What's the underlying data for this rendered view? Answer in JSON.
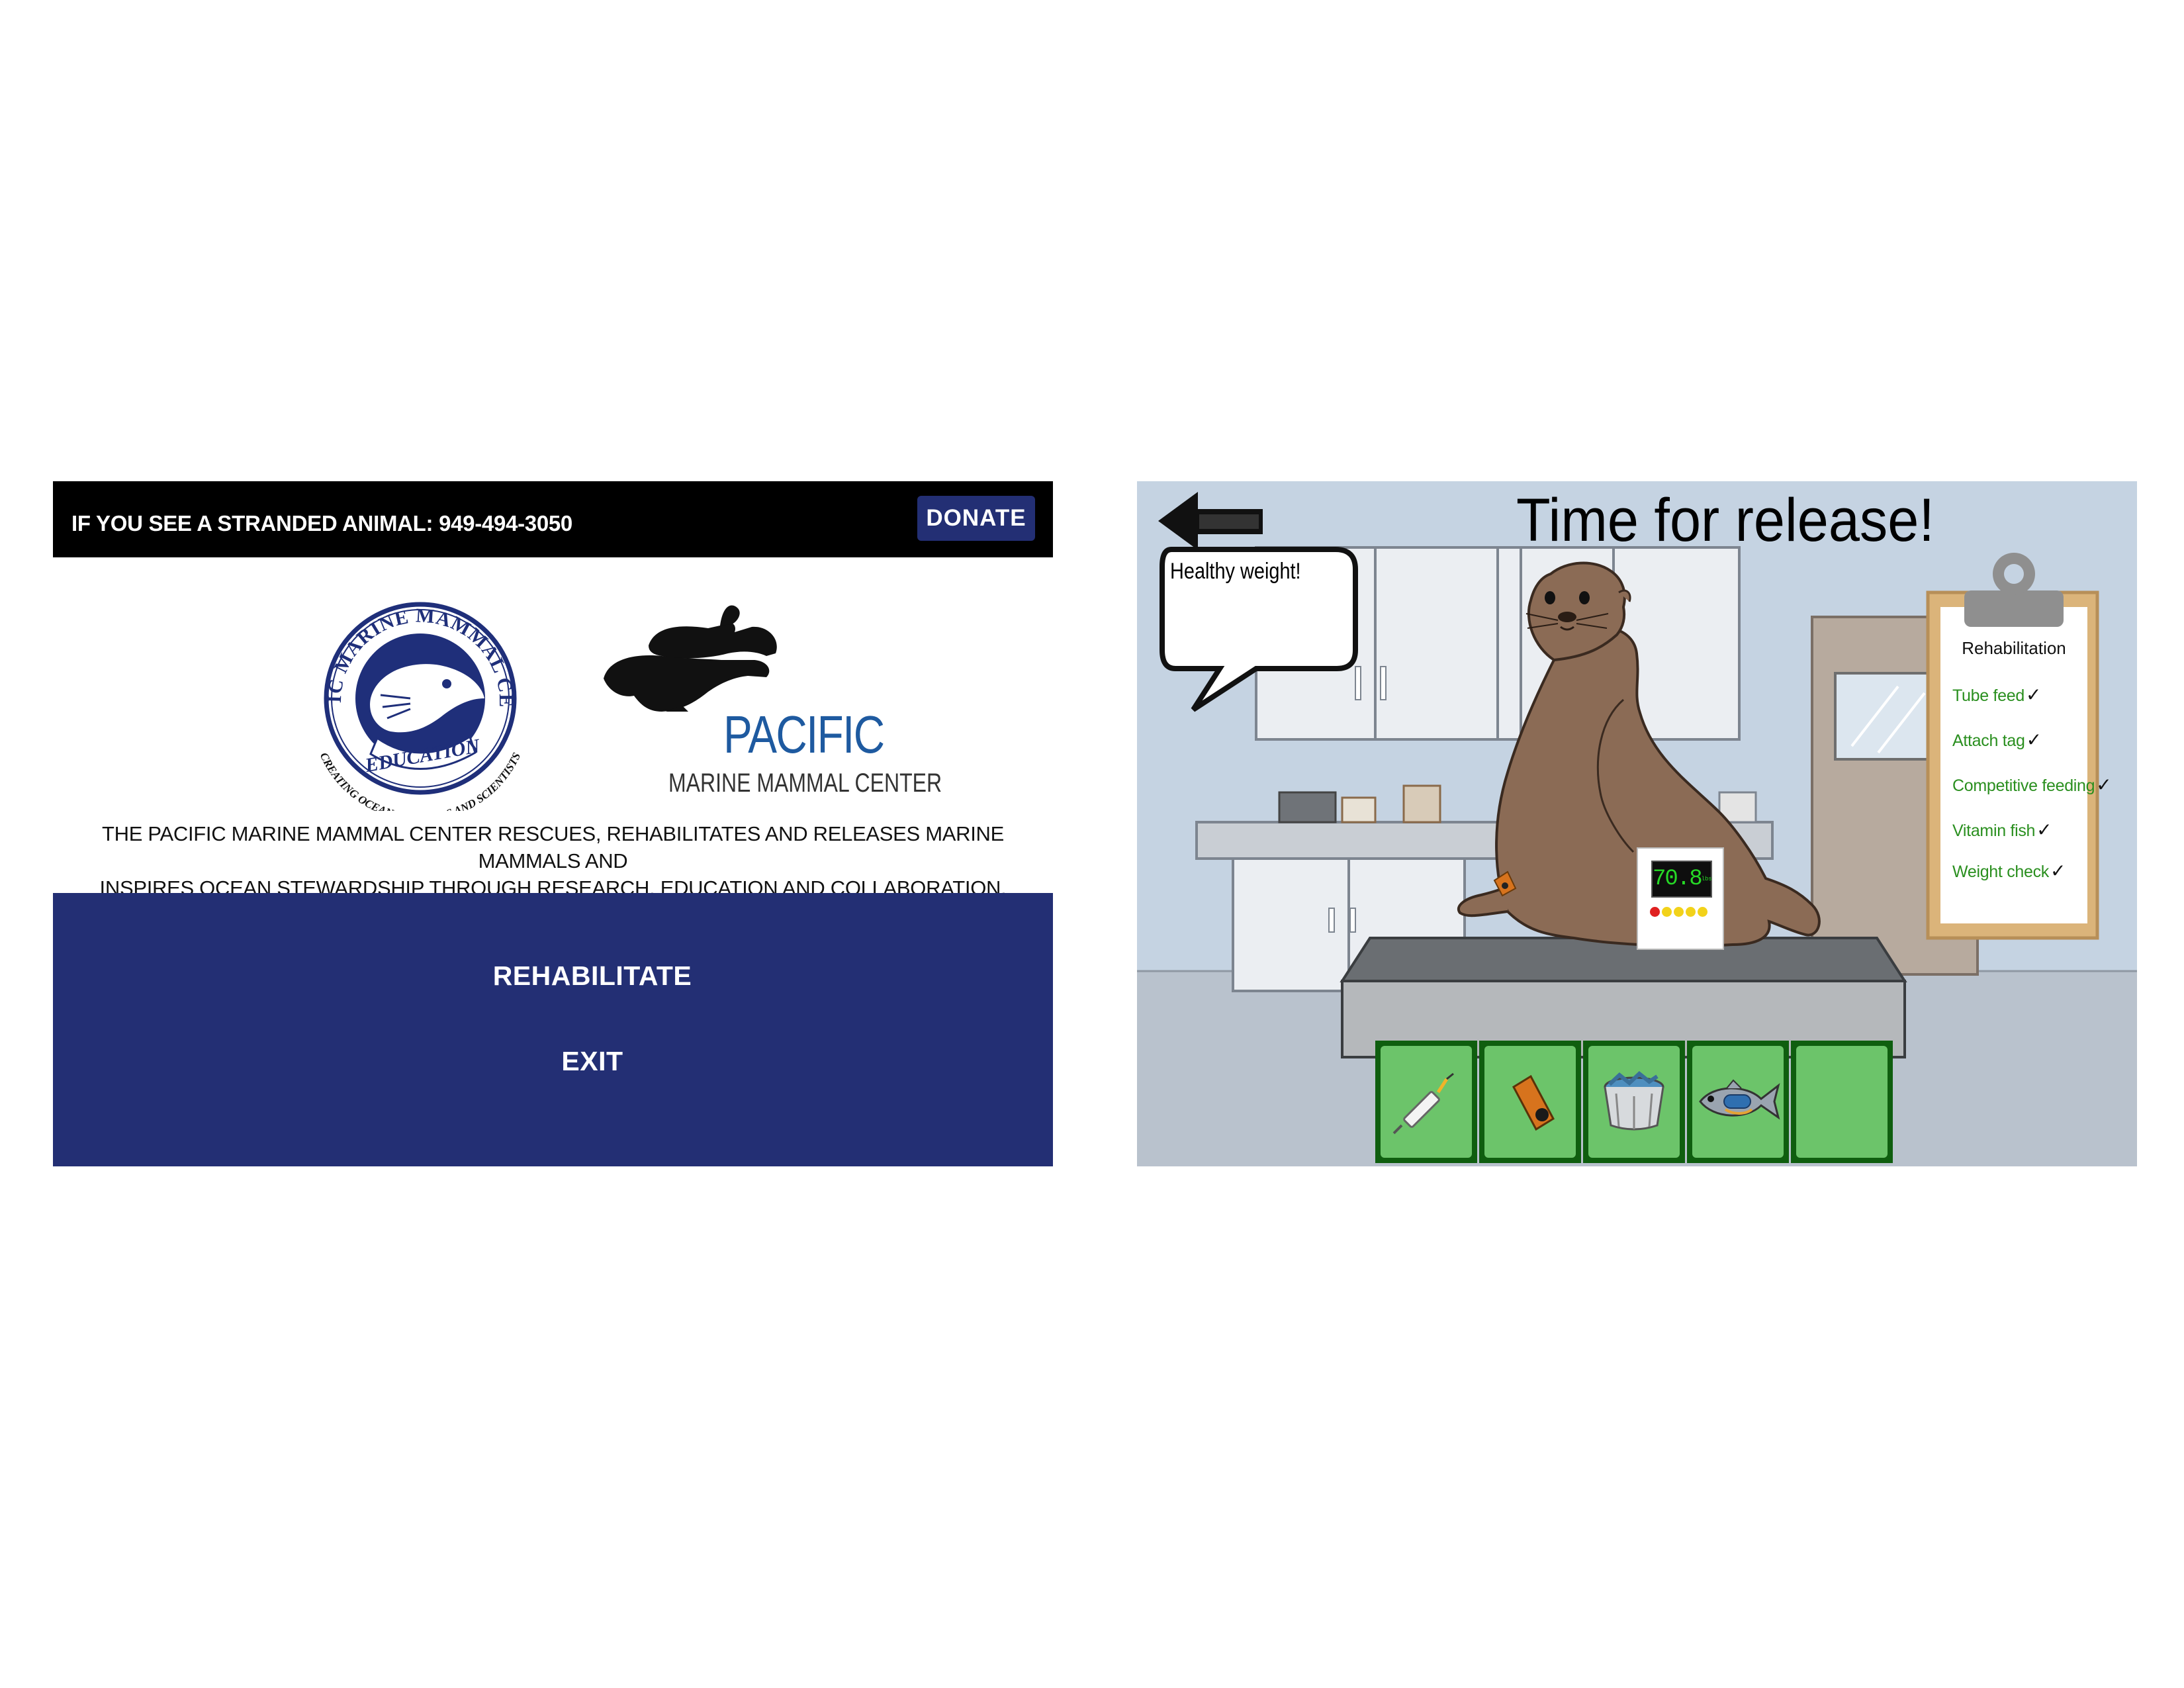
{
  "left_screen": {
    "top_bar": {
      "hotline_text": "IF YOU SEE A STRANDED ANIMAL: 949-494-3050",
      "donate_label": "DONATE"
    },
    "logos": {
      "education_ring_top": "PACIFIC MARINE MAMMAL CENTER",
      "education_banner": "EDUCATION",
      "education_ring_bottom": "CREATING OCEAN STEWARDS AND SCIENTISTS",
      "pmmc_word_1": "PACIFIC",
      "pmmc_word_2": "MARINE MAMMAL CENTER"
    },
    "mission_line_1": "THE PACIFIC MARINE MAMMAL CENTER RESCUES, REHABILITATES AND RELEASES MARINE MAMMALS AND",
    "mission_line_2": "INSPIRES OCEAN STEWARDSHIP THROUGH RESEARCH, EDUCATION AND COLLABORATION.",
    "menu": {
      "rehabilitate_label": "REHABILITATE",
      "exit_label": "EXIT"
    }
  },
  "right_screen": {
    "title": "Time for release!",
    "speech_bubble": "Healthy weight!",
    "scale_reading": "70.8",
    "scale_unit": "lbs",
    "clipboard": {
      "title": "Rehabilitation",
      "tasks": [
        {
          "label": "Tube feed",
          "done": true
        },
        {
          "label": "Attach tag",
          "done": true
        },
        {
          "label": "Competitive feeding",
          "done": true
        },
        {
          "label": "Vitamin fish",
          "done": true
        },
        {
          "label": "Weight check",
          "done": true
        }
      ],
      "check_glyph": "✓"
    },
    "toolbar_items": [
      {
        "icon": "syringe-icon"
      },
      {
        "icon": "tag-icon"
      },
      {
        "icon": "fish-bucket-icon"
      },
      {
        "icon": "vitamin-fish-icon"
      },
      {
        "icon": "empty-slot"
      }
    ]
  },
  "colors": {
    "navy": "#232f74",
    "black_bar": "#000000",
    "logo_blue": "#1e5aa0",
    "task_green": "#2a8f1f",
    "slot_green": "#6cc46a",
    "slot_border": "#0f5e0f",
    "wall": "#c5d3e2",
    "sea_lion": "#8b6b55"
  }
}
